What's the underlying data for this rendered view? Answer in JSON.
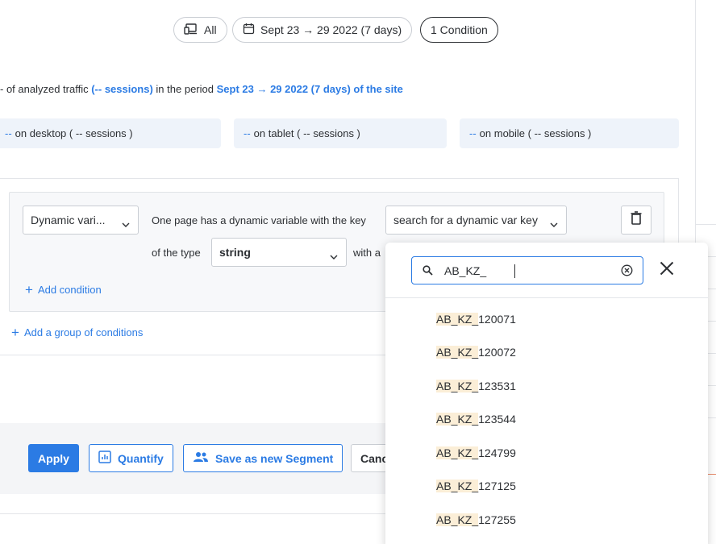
{
  "filters": {
    "device": "All",
    "date_range": "Sept 23 → 29 2022 (7 days)",
    "conditions": "1 Condition"
  },
  "summary": {
    "prefix": "- of analyzed traffic",
    "sessions": "(-- sessions)",
    "middle": "in the period",
    "period": "Sept 23 → 29 2022 (7 days) of the site"
  },
  "devices": [
    {
      "dash": "--",
      "label": "on desktop ( -- sessions )"
    },
    {
      "dash": "--",
      "label": "on tablet ( -- sessions )"
    },
    {
      "dash": "--",
      "label": "on mobile ( -- sessions )"
    }
  ],
  "condition": {
    "type_select": "Dynamic vari...",
    "text1": "One page has a dynamic variable with the key",
    "key_select": "search for a dynamic var key",
    "text2": "of the type",
    "value_type": "string",
    "text3": "with a",
    "add_condition": "Add condition",
    "add_group": "Add a group of conditions"
  },
  "footer": {
    "apply": "Apply",
    "quantify": "Quantify",
    "save_segment": "Save as new Segment",
    "cancel": "Canc"
  },
  "dropdown": {
    "search_value": "AB_KZ_",
    "highlight": "AB_KZ_",
    "options": [
      "120071",
      "120072",
      "123531",
      "123544",
      "124799",
      "127125",
      "127255"
    ]
  },
  "colors": {
    "accent": "#2b7be4",
    "highlight": "#fbeed7",
    "text": "#2c2f33"
  }
}
